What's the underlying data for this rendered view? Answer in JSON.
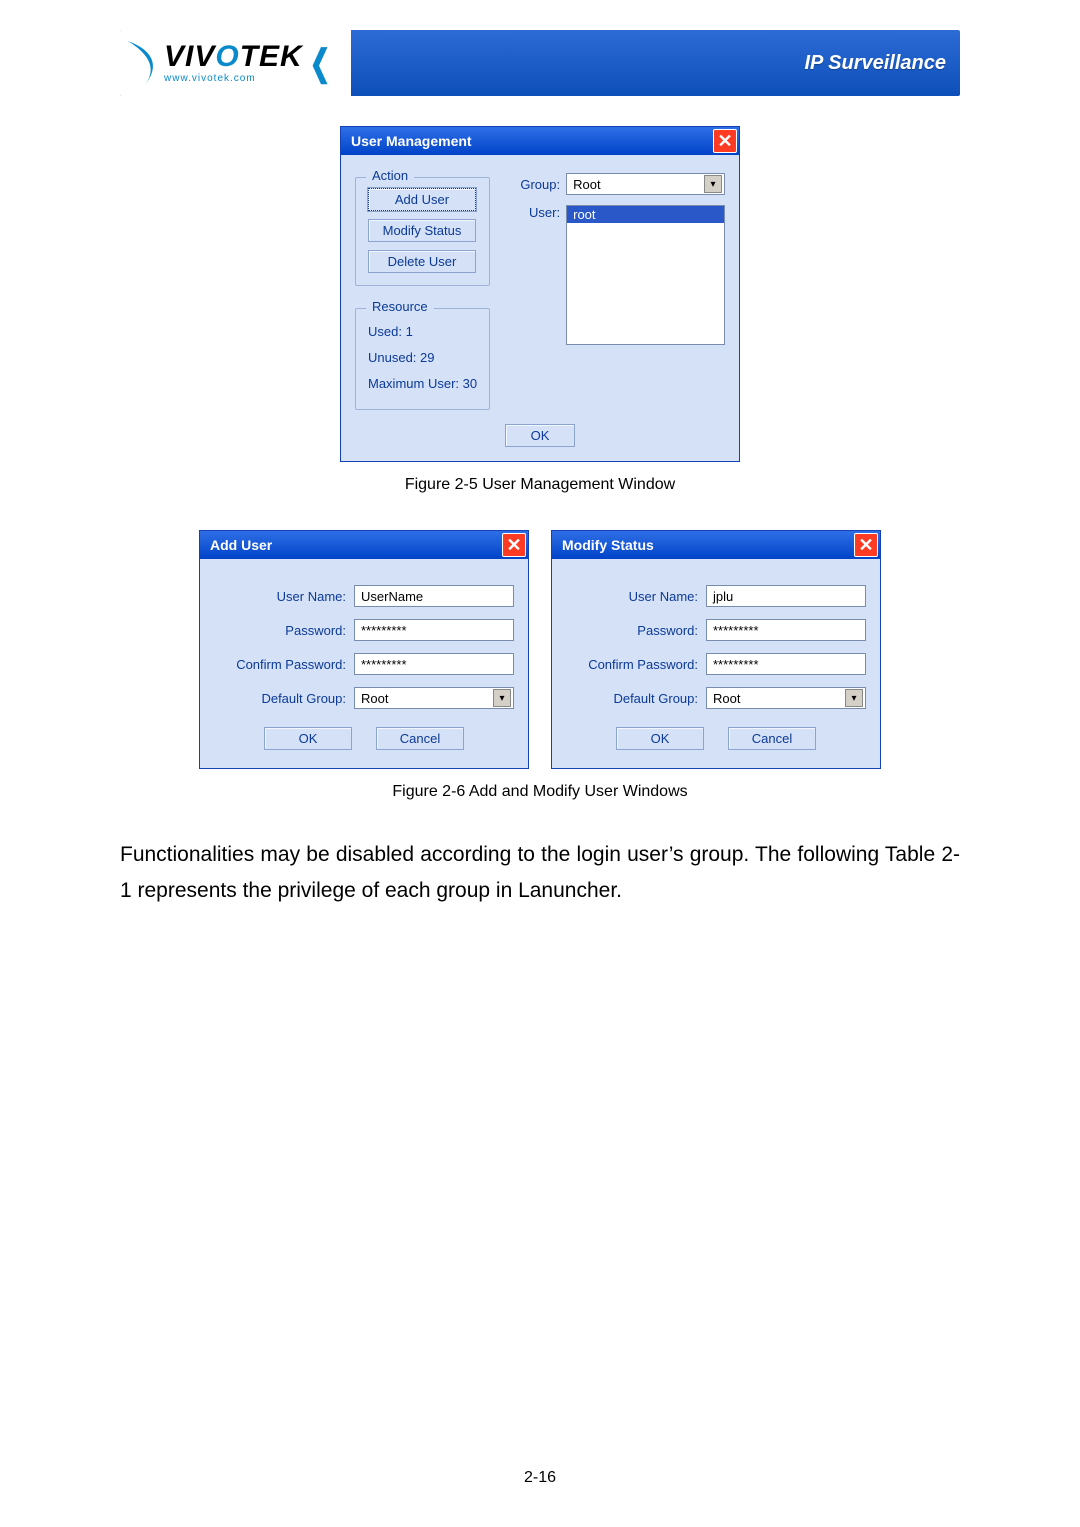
{
  "banner": {
    "brand_left": "VIV",
    "brand_o": "O",
    "brand_right": "TEK",
    "url": "www.vivotek.com",
    "tagline": "IP Surveillance"
  },
  "user_mgmt": {
    "title": "User Management",
    "action_legend": "Action",
    "add_user": "Add User",
    "modify_status": "Modify Status",
    "delete_user": "Delete User",
    "group_label": "Group:",
    "group_value": "Root",
    "user_label": "User:",
    "user_selected": "root",
    "resource_legend": "Resource",
    "used_label": "Used:",
    "used_value": "1",
    "unused_label": "Unused:",
    "unused_value": "29",
    "max_label": "Maximum User:",
    "max_value": "30",
    "ok": "OK"
  },
  "fig1_caption": "Figure 2-5 User Management Window",
  "add_user_dlg": {
    "title": "Add User",
    "username_label": "User Name:",
    "username_value": "UserName",
    "password_label": "Password:",
    "password_value": "*********",
    "confirm_label": "Confirm Password:",
    "confirm_value": "*********",
    "default_group_label": "Default Group:",
    "default_group_value": "Root",
    "ok": "OK",
    "cancel": "Cancel"
  },
  "modify_dlg": {
    "title": "Modify Status",
    "username_label": "User Name:",
    "username_value": "jplu",
    "password_label": "Password:",
    "password_value": "*********",
    "confirm_label": "Confirm Password:",
    "confirm_value": "*********",
    "default_group_label": "Default Group:",
    "default_group_value": "Root",
    "ok": "OK",
    "cancel": "Cancel"
  },
  "fig2_caption": "Figure 2-6 Add and Modify User Windows",
  "paragraph": "Functionalities may be disabled according to the login user’s group. The following Table 2-1 represents the privilege of each group in Lanuncher.",
  "page_number": "2-16"
}
